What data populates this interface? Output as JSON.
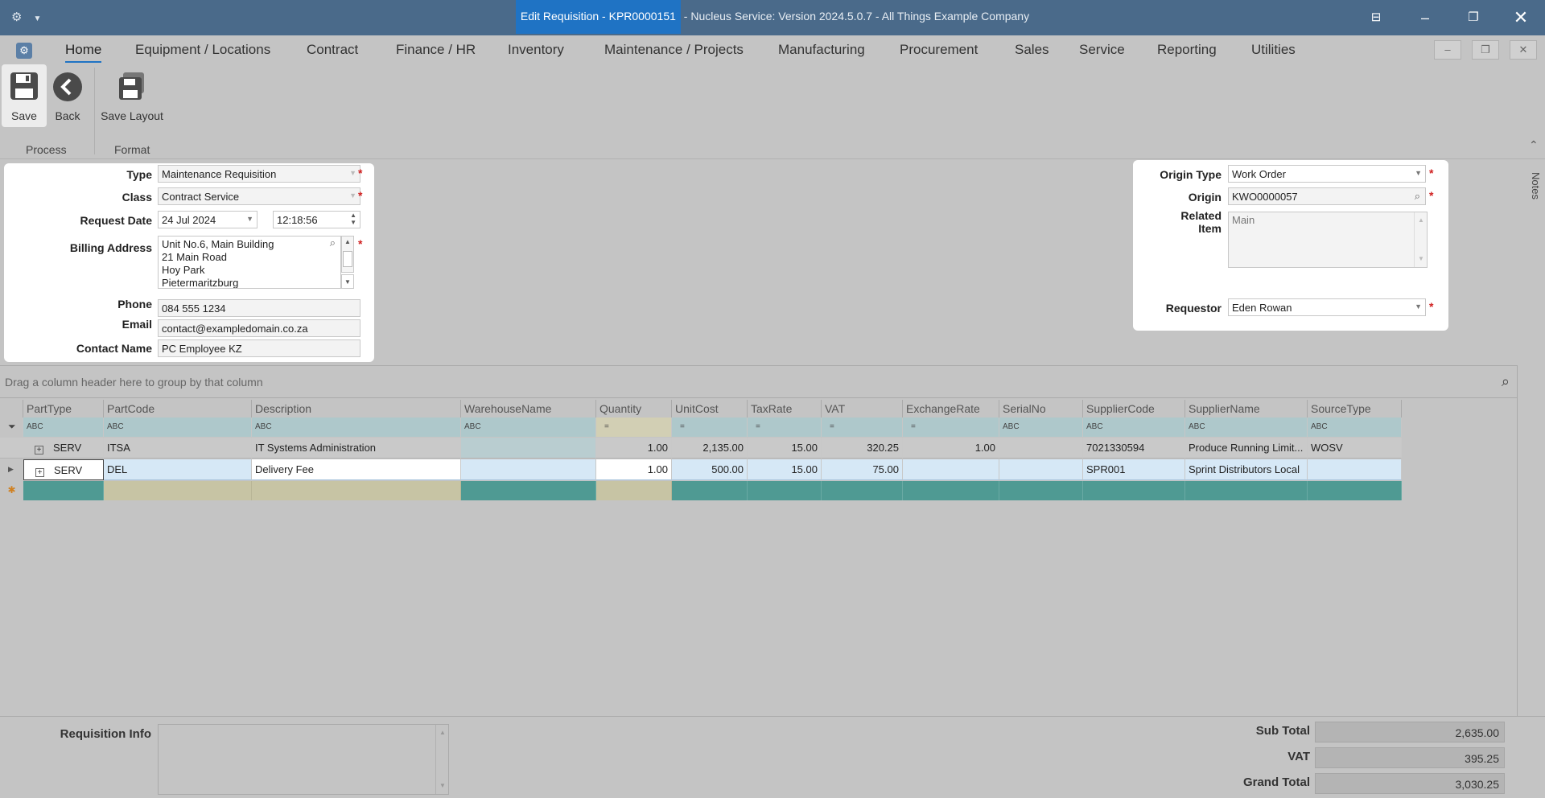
{
  "window": {
    "title_highlight": "Edit Requisition - KPR0000151",
    "title_rest": " - Nucleus Service: Version 2024.5.0.7 - All Things Example Company"
  },
  "menu": {
    "items": [
      "Home",
      "Equipment / Locations",
      "Contract",
      "Finance / HR",
      "Inventory",
      "Maintenance / Projects",
      "Manufacturing",
      "Procurement",
      "Sales",
      "Service",
      "Reporting",
      "Utilities"
    ]
  },
  "ribbon": {
    "save": "Save",
    "back": "Back",
    "save_layout": "Save Layout",
    "group_process": "Process",
    "group_format": "Format"
  },
  "form": {
    "type_label": "Type",
    "type_value": "Maintenance Requisition",
    "class_label": "Class",
    "class_value": "Contract Service",
    "request_date_label": "Request Date",
    "request_date_value": "24 Jul 2024",
    "request_time_value": "12:18:56",
    "billing_label": "Billing Address",
    "billing_lines": [
      "Unit No.6, Main Building",
      "21 Main Road",
      "Hoy Park",
      "Pietermaritzburg"
    ],
    "phone_label": "Phone",
    "phone_value": "084 555 1234",
    "email_label": "Email",
    "email_value": "contact@exampledomain.co.za",
    "contact_label": "Contact Name",
    "contact_value": "PC Employee KZ"
  },
  "origin": {
    "origin_type_label": "Origin Type",
    "origin_type_value": "Work Order",
    "origin_label": "Origin",
    "origin_value": "KWO0000057",
    "related_label_1": "Related",
    "related_label_2": "Item",
    "related_value": "Main",
    "requestor_label": "Requestor",
    "requestor_value": "Eden Rowan"
  },
  "grid": {
    "group_hint": "Drag a column header here to group by that column",
    "columns": [
      "PartType",
      "PartCode",
      "Description",
      "WarehouseName",
      "Quantity",
      "UnitCost",
      "TaxRate",
      "VAT",
      "ExchangeRate",
      "SerialNo",
      "SupplierCode",
      "SupplierName",
      "SourceType"
    ],
    "rows": [
      [
        "SERV",
        "ITSA",
        "IT Systems Administration",
        "",
        "1.00",
        "2,135.00",
        "15.00",
        "320.25",
        "1.00",
        "",
        "7021330594",
        "Produce Running Limit...",
        "WOSV"
      ],
      [
        "SERV",
        "DEL",
        "Delivery Fee",
        "",
        "1.00",
        "500.00",
        "15.00",
        "75.00",
        "",
        "",
        "SPR001",
        "Sprint Distributors Local",
        ""
      ]
    ]
  },
  "footer": {
    "info_label": "Requisition Info",
    "subtotal_label": "Sub Total",
    "subtotal_value": "2,635.00",
    "vat_label": "VAT",
    "vat_value": "395.25",
    "grand_label": "Grand Total",
    "grand_value": "3,030.25"
  },
  "side": {
    "notes": "Notes"
  }
}
